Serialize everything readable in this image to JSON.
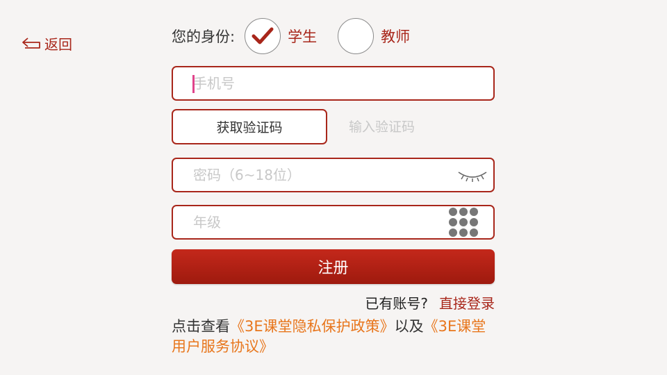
{
  "nav": {
    "back_label": "返回"
  },
  "identity": {
    "label": "您的身份:",
    "options": [
      {
        "label": "学生",
        "selected": true
      },
      {
        "label": "教师",
        "selected": false
      }
    ]
  },
  "form": {
    "phone_placeholder": "手机号",
    "get_code_label": "获取验证码",
    "code_placeholder": "输入验证码",
    "password_placeholder": "密码（6~18位）",
    "grade_placeholder": "年级",
    "submit_label": "注册"
  },
  "login": {
    "question": "已有账号?",
    "link": "直接登录"
  },
  "policy": {
    "prefix": "点击查看",
    "privacy_link": "《3E课堂隐私保护政策》",
    "connector": "以及",
    "terms_link": "《3E课堂用户服务协议》"
  },
  "colors": {
    "accent": "#a8261a",
    "link_orange": "#e8761c",
    "caret": "#e0448b"
  }
}
